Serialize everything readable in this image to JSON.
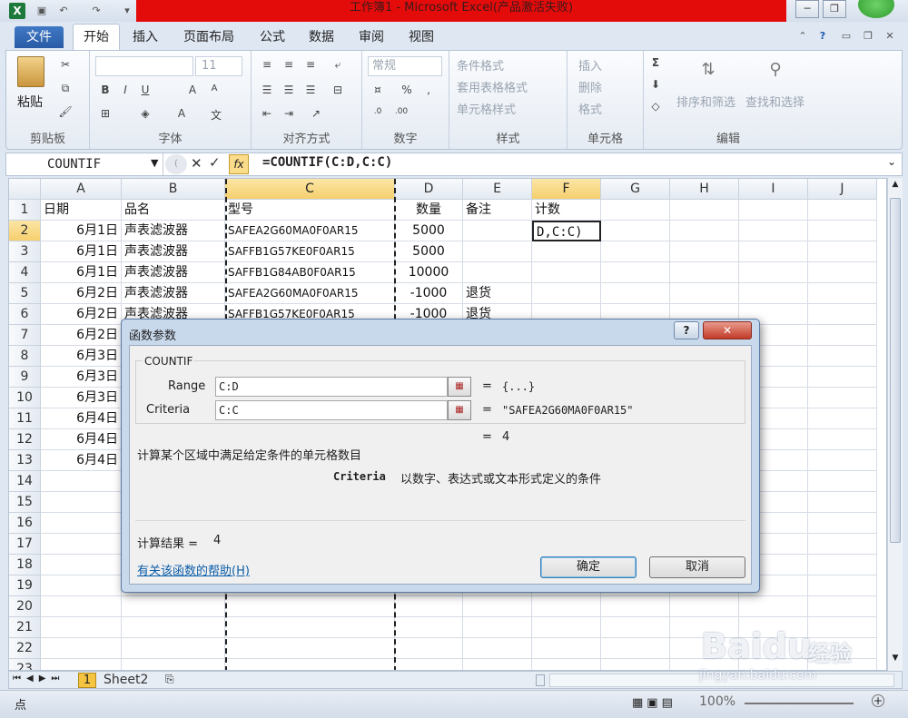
{
  "window": {
    "title": "工作簿1 - Microsoft Excel(产品激活失败)"
  },
  "ribbon_tabs": [
    "文件",
    "开始",
    "插入",
    "页面布局",
    "公式",
    "数据",
    "审阅",
    "视图"
  ],
  "ribbon": {
    "clipboard": {
      "paste": "粘贴",
      "label": "剪贴板"
    },
    "font": {
      "size": "11",
      "label": "字体"
    },
    "alignment": {
      "label": "对齐方式"
    },
    "number": {
      "format": "常规",
      "label": "数字"
    },
    "styles": {
      "conditional": "条件格式",
      "table": "套用表格格式",
      "cell": "单元格样式",
      "label": "样式"
    },
    "cells": {
      "insert": "插入",
      "delete": "删除",
      "format": "格式",
      "label": "单元格"
    },
    "editing": {
      "sort": "排序和筛选",
      "find": "查找和选择",
      "label": "编辑"
    }
  },
  "formula_bar": {
    "name_box": "COUNTIF",
    "formula": "=COUNTIF(C:D,C:C)"
  },
  "columns": [
    "A",
    "B",
    "C",
    "D",
    "E",
    "F",
    "G",
    "H",
    "I",
    "J"
  ],
  "rows": [
    "1",
    "2",
    "3",
    "4",
    "5",
    "6",
    "7",
    "8",
    "9",
    "10",
    "11",
    "12",
    "13",
    "14",
    "15",
    "16",
    "17",
    "18",
    "19",
    "20",
    "21",
    "22",
    "23"
  ],
  "sheet": {
    "header": [
      "日期",
      "品名",
      "型号",
      "数量",
      "备注",
      "计数"
    ],
    "data": [
      [
        "6月1日",
        "声表滤波器",
        "SAFEA2G60MA0F0AR15",
        "5000",
        "",
        "D,C:C)"
      ],
      [
        "6月1日",
        "声表滤波器",
        "SAFFB1G57KE0F0AR15",
        "5000",
        "",
        ""
      ],
      [
        "6月1日",
        "声表滤波器",
        "SAFFB1G84AB0F0AR15",
        "10000",
        "",
        ""
      ],
      [
        "6月2日",
        "声表滤波器",
        "SAFEA2G60MA0F0AR15",
        "-1000",
        "退货",
        ""
      ],
      [
        "6月2日",
        "声表滤波器",
        "SAFFB1G57KE0F0AR15",
        "-1000",
        "退货",
        ""
      ],
      [
        "6月2日",
        "",
        "",
        "",
        "",
        ""
      ],
      [
        "6月3日",
        "",
        "",
        "",
        "",
        ""
      ],
      [
        "6月3日",
        "",
        "",
        "",
        "",
        ""
      ],
      [
        "6月3日",
        "",
        "",
        "",
        "",
        ""
      ],
      [
        "6月4日",
        "",
        "",
        "",
        "",
        ""
      ],
      [
        "6月4日",
        "",
        "",
        "",
        "",
        ""
      ],
      [
        "6月4日",
        "",
        "",
        "",
        "",
        ""
      ]
    ]
  },
  "sheet_tabs": {
    "active": "1",
    "other": "Sheet2"
  },
  "status": {
    "mode": "点",
    "zoom": "100%"
  },
  "dialog": {
    "title": "函数参数",
    "function_name": "COUNTIF",
    "range_label": "Range",
    "range_value": "C:D",
    "range_result": "{...}",
    "criteria_label": "Criteria",
    "criteria_value": "C:C",
    "criteria_result": "\"SAFEA2G60MA0F0AR15\"",
    "eq": "=",
    "formula_result": "4",
    "description": "计算某个区域中满足给定条件的单元格数目",
    "param_name": "Criteria",
    "param_desc": "以数字、表达式或文本形式定义的条件",
    "calc_label": "计算结果 =",
    "calc_value": "4",
    "help_link": "有关该函数的帮助(H)",
    "ok": "确定",
    "cancel": "取消",
    "help_btn": "?",
    "close_btn": "✕"
  },
  "watermark": {
    "brand": "Baidu",
    "sub": "经验",
    "url": "jingyan.baidu.com"
  }
}
